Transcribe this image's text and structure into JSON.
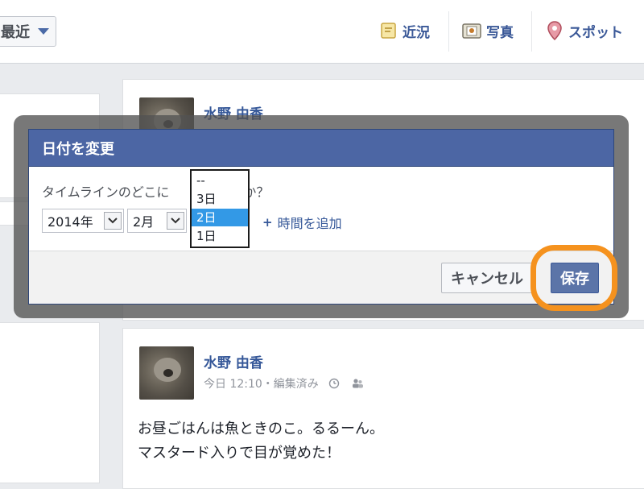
{
  "topbar": {
    "sort_label": "最近",
    "composer": {
      "status": "近況",
      "photo": "写真",
      "place": "スポット"
    }
  },
  "posts": [
    {
      "author": "水野 由香",
      "meta": ""
    },
    {
      "author": "水野 由香",
      "meta": "今日 12:10・編集済み",
      "lines": [
        "お昼ごはんは魚ときのこ。るるーん。",
        "マスタード入りで目が覚めた！"
      ]
    }
  ],
  "dialog": {
    "title": "日付を変更",
    "question_before": "タイムラインのどこに",
    "question_after": "すか？",
    "year_value": "2014年",
    "month_value": "2月",
    "add_time_label": "時間を追加",
    "cancel_label": "キャンセル",
    "save_label": "保存",
    "day_dropdown": {
      "options": [
        "--",
        "3日",
        "2日",
        "1日"
      ],
      "selected": "2日"
    }
  },
  "colors": {
    "header_blue": "#4c66a4",
    "link_blue": "#365899",
    "highlight_orange": "#f5921e",
    "selected_option": "#3399e6"
  },
  "icons": [
    "caret-down-icon",
    "status-note-icon",
    "photo-icon",
    "map-pin-icon",
    "clock-icon",
    "audience-icon",
    "plus-icon"
  ]
}
